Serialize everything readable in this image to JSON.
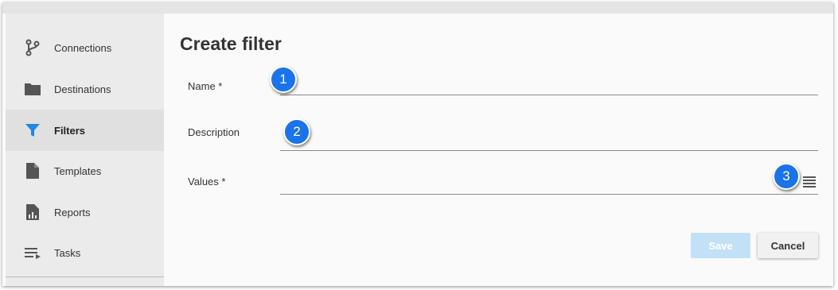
{
  "sidebar": {
    "items": [
      {
        "label": "Connections",
        "icon": "branch-icon"
      },
      {
        "label": "Destinations",
        "icon": "folder-icon"
      },
      {
        "label": "Filters",
        "icon": "filter-icon",
        "active": true
      },
      {
        "label": "Templates",
        "icon": "document-icon"
      },
      {
        "label": "Reports",
        "icon": "report-icon"
      },
      {
        "label": "Tasks",
        "icon": "playlist-icon"
      }
    ]
  },
  "main": {
    "title": "Create filter",
    "fields": {
      "name": {
        "label": "Name *",
        "value": ""
      },
      "description": {
        "label": "Description",
        "value": ""
      },
      "values": {
        "label": "Values *",
        "value": ""
      }
    },
    "callouts": [
      "1",
      "2",
      "3"
    ],
    "buttons": {
      "save": "Save",
      "cancel": "Cancel"
    }
  },
  "colors": {
    "accent": "#1a73e8",
    "active_icon": "#1e88e5",
    "save_disabled": "#c2e1f7"
  }
}
